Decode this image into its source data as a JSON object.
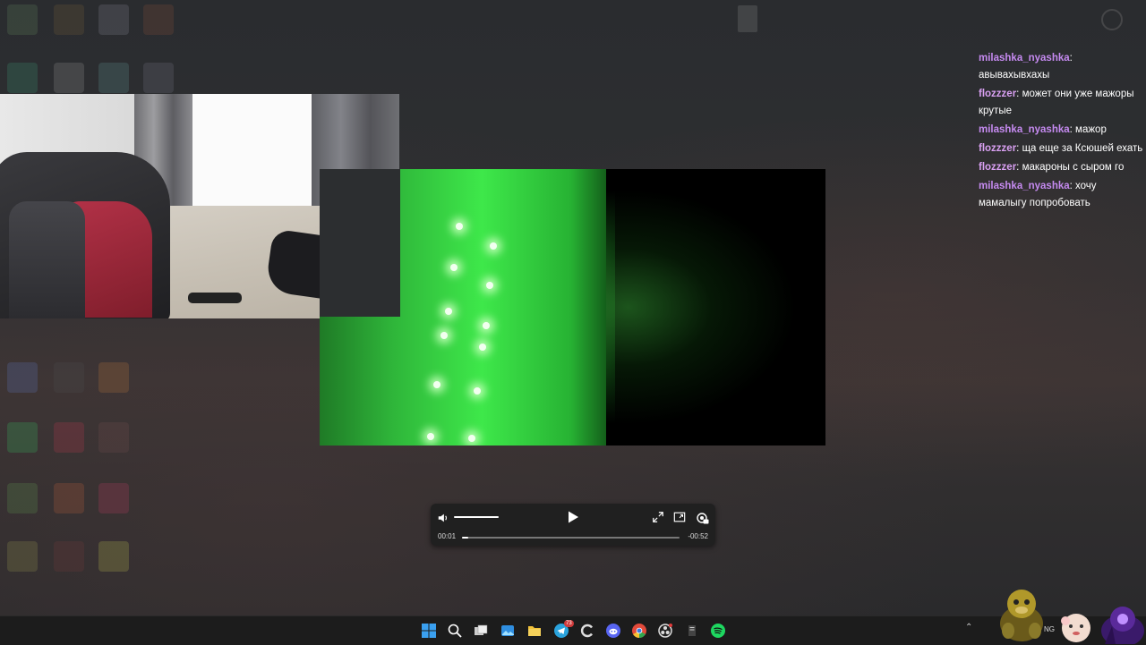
{
  "chat": {
    "messages": [
      {
        "user": "milashka_nyashka",
        "sep": ": ",
        "text": "авывахывхахы",
        "color": "#c58af0"
      },
      {
        "user": "flozzzer",
        "sep": ": ",
        "text": "может они уже мажоры крутые",
        "color": "#d9a0f2"
      },
      {
        "user": "milashka_nyashka",
        "sep": ": ",
        "text": "мажор",
        "color": "#c58af0"
      },
      {
        "user": "flozzzer",
        "sep": ": ",
        "text": "ща еще за Ксюшей ехать",
        "color": "#d9a0f2"
      },
      {
        "user": "flozzzer",
        "sep": ": ",
        "text": "макароны с сыром го",
        "color": "#d9a0f2"
      },
      {
        "user": "milashka_nyashka",
        "sep": ": ",
        "text": "хочу мамалыгу попробовать",
        "color": "#c58af0"
      }
    ]
  },
  "player": {
    "current_time": "00:01",
    "remaining_time": "-00:52",
    "progress_fraction": 0.03,
    "volume_fraction": 1.0,
    "icons": [
      "volume-icon",
      "play-icon",
      "fullscreen-icon",
      "picture-in-picture-icon",
      "settings-icon"
    ]
  },
  "taskbar": {
    "language": "NG",
    "telegram_badge": "73",
    "icons": [
      "windows-start-icon",
      "search-icon",
      "task-view-icon",
      "photos-icon",
      "file-explorer-icon",
      "telegram-icon",
      "ccleaner-icon",
      "discord-icon",
      "chrome-icon",
      "obs-icon",
      "notepad-icon",
      "spotify-icon"
    ]
  },
  "colors": {
    "accent_green": "#3ee84a",
    "chat_user": "#c58af0",
    "taskbar_bg": "#1c1c1c"
  }
}
